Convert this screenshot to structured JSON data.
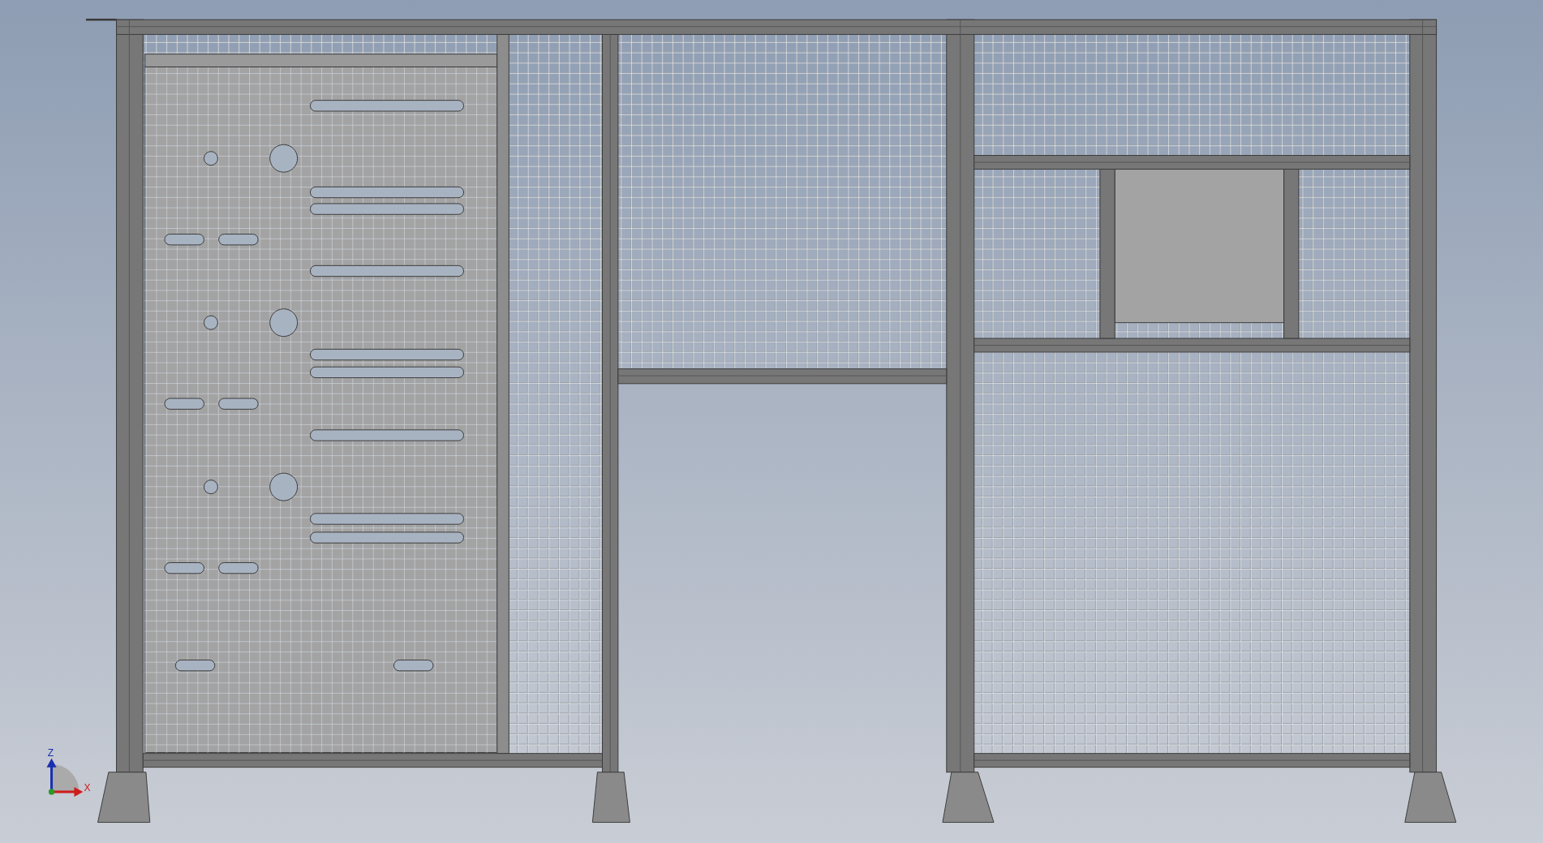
{
  "viewport": {
    "triad": {
      "axes": [
        {
          "label": "Z",
          "kind": "vertical"
        },
        {
          "label": "X",
          "kind": "horizontal"
        }
      ]
    }
  }
}
